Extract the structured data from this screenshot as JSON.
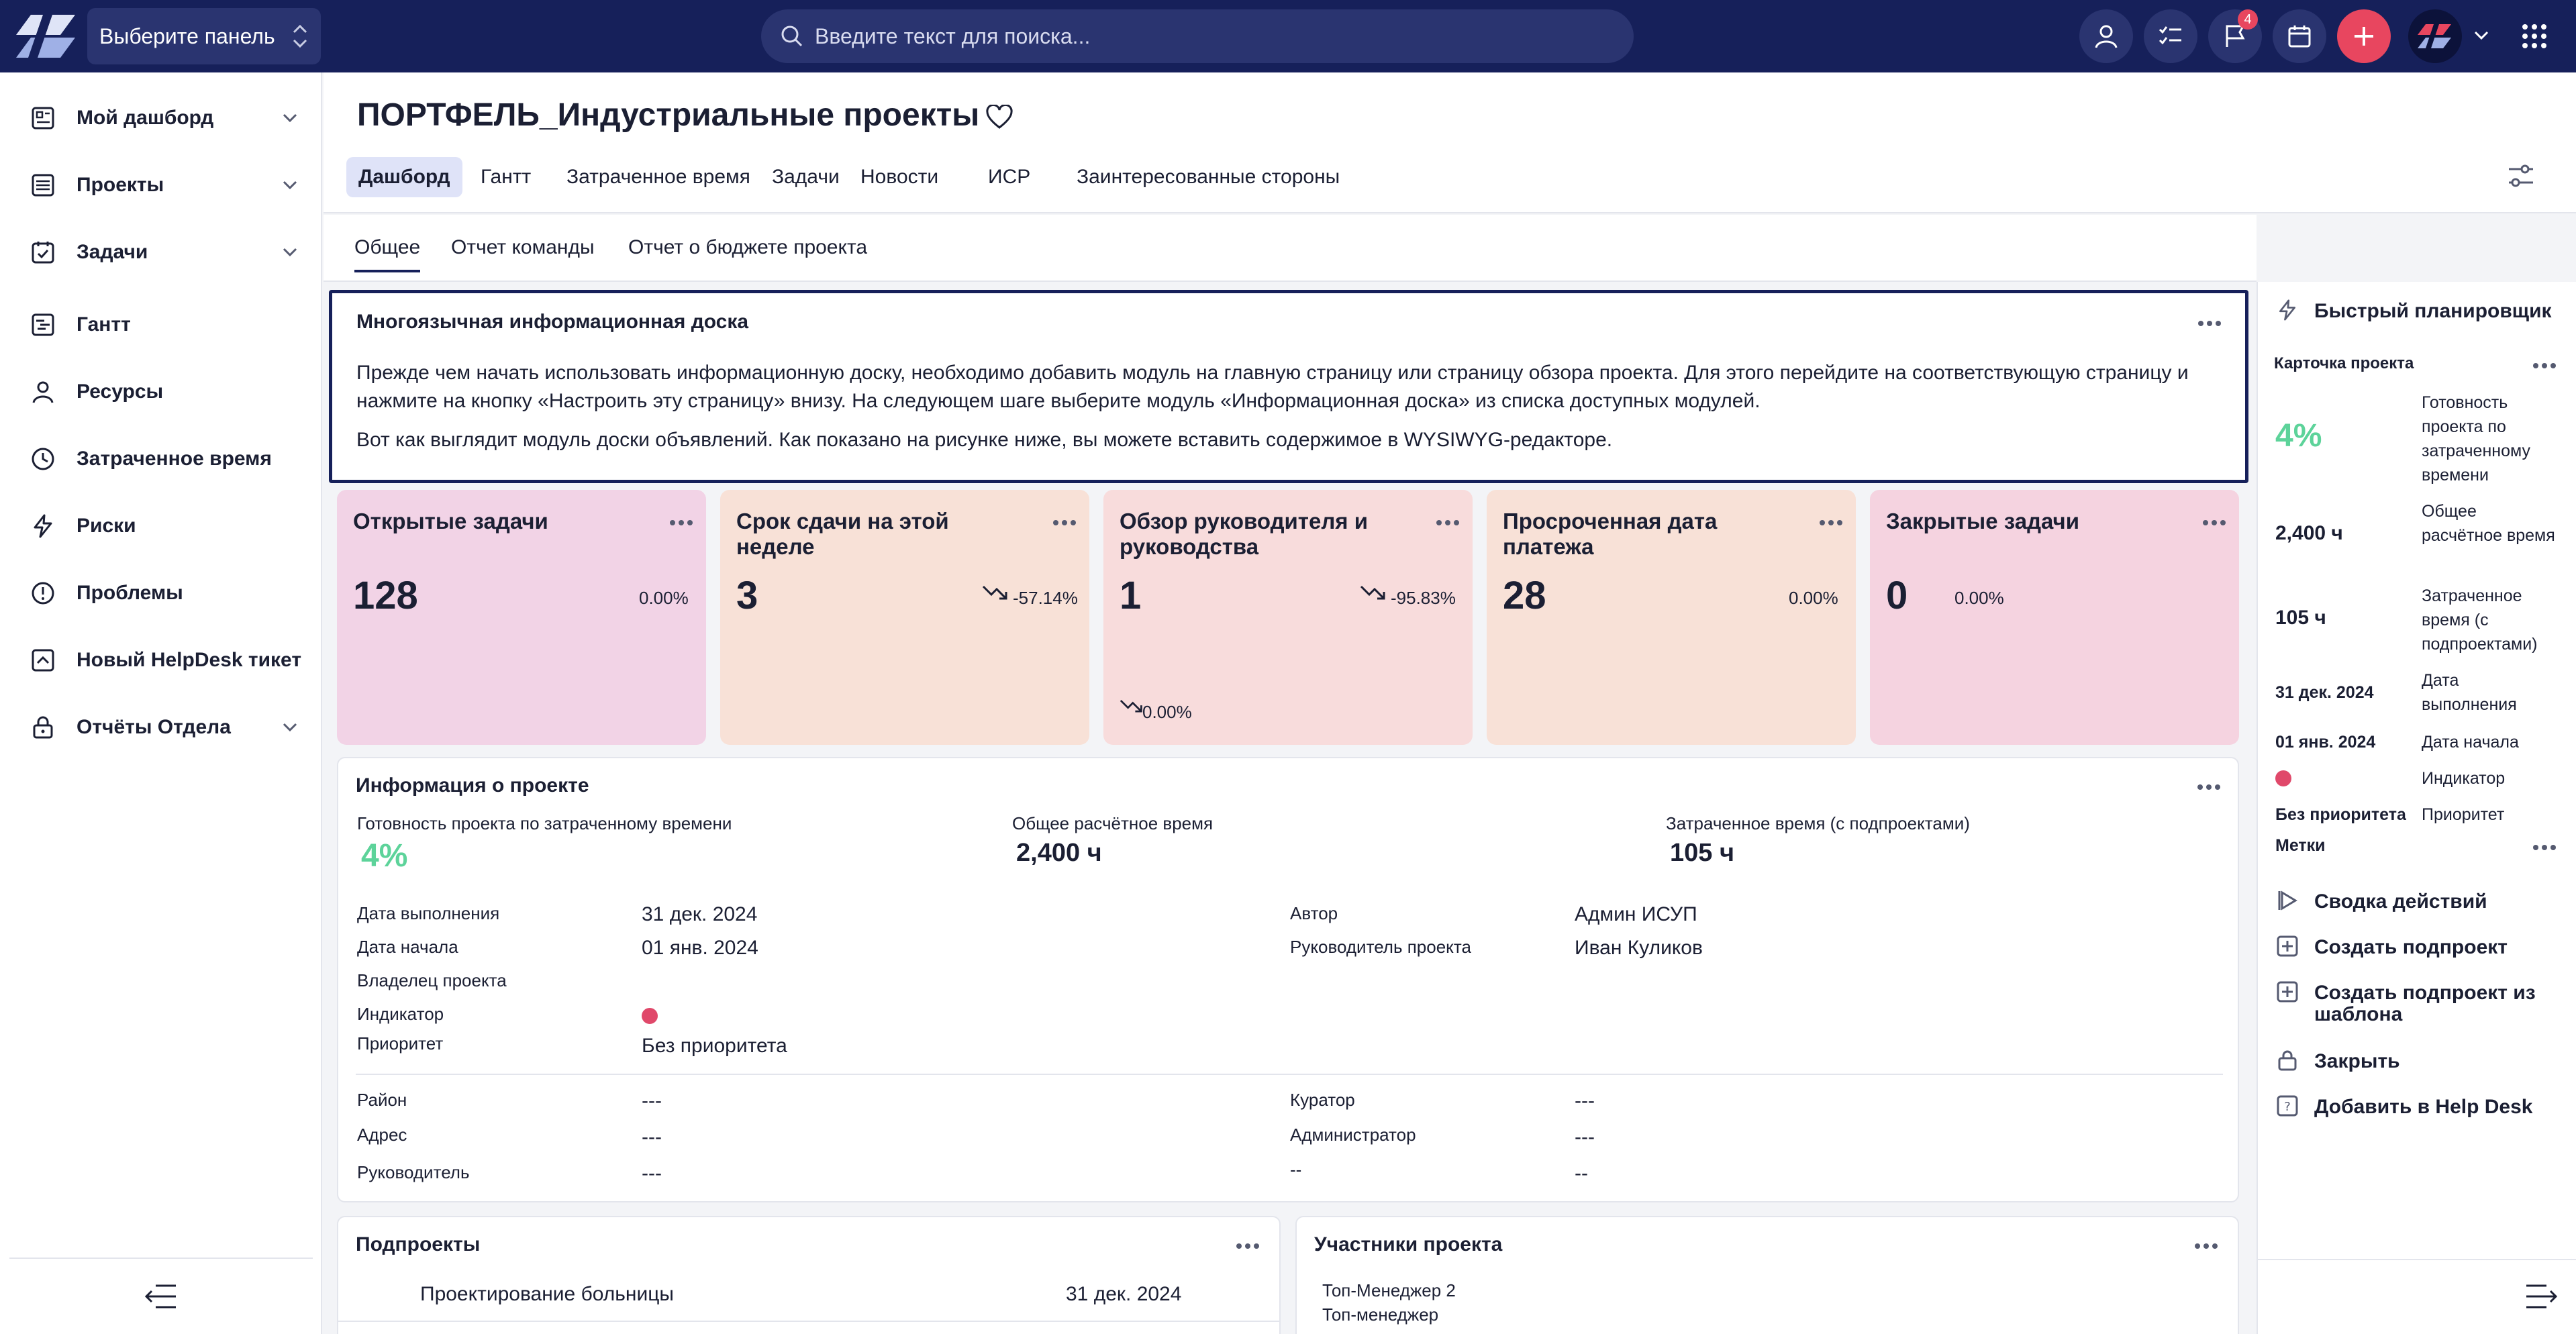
{
  "topbar": {
    "panel_select": "Выберите панель",
    "search_placeholder": "Введите текст для поиска...",
    "notifications_badge": "4",
    "colors": {
      "bar": "#16205a",
      "accent": "#e8465f"
    }
  },
  "sidebar": {
    "items": [
      {
        "label": "Мой дашборд",
        "icon": "dashboard-icon",
        "has_children": true
      },
      {
        "label": "Проекты",
        "icon": "projects-icon",
        "has_children": true
      },
      {
        "label": "Задачи",
        "icon": "tasks-icon",
        "has_children": true
      },
      {
        "label": "Гантт",
        "icon": "gantt-icon",
        "has_children": false
      },
      {
        "label": "Ресурсы",
        "icon": "user-icon",
        "has_children": false
      },
      {
        "label": "Затраченное время",
        "icon": "clock-icon",
        "has_children": false
      },
      {
        "label": "Риски",
        "icon": "lightning-icon",
        "has_children": false
      },
      {
        "label": "Проблемы",
        "icon": "alert-icon",
        "has_children": false
      },
      {
        "label": "Новый HelpDesk тикет",
        "icon": "helpdesk-icon",
        "has_children": false
      },
      {
        "label": "Отчёты Отдела",
        "icon": "lock-icon",
        "has_children": true
      }
    ]
  },
  "header": {
    "title": "ПОРТФЕЛЬ_Индустриальные проекты",
    "tabs": [
      "Дашборд",
      "Гантт",
      "Затраченное время",
      "Задачи",
      "Новости",
      "ИСР",
      "Заинтересованные стороны"
    ],
    "active_tab": "Дашборд"
  },
  "subtabs": {
    "items": [
      "Общее",
      "Отчет команды",
      "Отчет о бюджете проекта"
    ],
    "active": "Общее"
  },
  "board": {
    "title": "Многоязычная информационная доска",
    "p1": "Прежде чем начать использовать информационную доску, необходимо добавить модуль на главную страницу или страницу обзора проекта. Для этого перейдите на соответствующую страницу и",
    "p1b": "нажмите на кнопку «Настроить эту страницу» внизу. На следующем шаге выберите модуль «Информационная доска» из списка доступных модулей.",
    "p2": "Вот как выглядит модуль доски объявлений. Как показано на рисунке ниже, вы можете вставить содержимое в WYSIWYG-редакторе."
  },
  "kpis": [
    {
      "title": "Открытые задачи",
      "value": "128",
      "pct": "0.00%",
      "bg": "#f2d3e6",
      "trend": false
    },
    {
      "title": "Срок сдачи на этой неделе",
      "value": "3",
      "pct": "-57.14%",
      "bg": "#f8e1d7",
      "trend": true
    },
    {
      "title": "Обзор руководителя и руководства",
      "value": "1",
      "pct": "-95.83%",
      "pct2": "0.00%",
      "bg": "#f8dcdc",
      "trend": true
    },
    {
      "title": "Просроченная дата платежа",
      "value": "28",
      "pct": "0.00%",
      "bg": "#f8e1d7",
      "trend": false
    },
    {
      "title": "Закрытые задачи",
      "value": "0",
      "pct": "0.00%",
      "bg": "#f5d3e0",
      "trend": false
    }
  ],
  "project_info": {
    "title": "Информация о проекте",
    "readiness_label": "Готовность проекта по затраченному времени",
    "readiness_value": "4%",
    "estimated_label": "Общее расчётное время",
    "estimated_value": "2,400 ч",
    "spent_label": "Затраченное время (с подпроектами)",
    "spent_value": "105 ч",
    "due_label": "Дата выполнения",
    "due_value": "31 дек. 2024",
    "start_label": "Дата начала",
    "start_value": "01 янв. 2024",
    "owner_label": "Владелец проекта",
    "indicator_label": "Индикатор",
    "priority_label": "Приоритет",
    "priority_value": "Без приоритета",
    "author_label": "Автор",
    "author_value": "Админ ИСУП",
    "manager_label": "Руководитель проекта",
    "manager_value": "Иван Куликов",
    "district_label": "Район",
    "district_value": "---",
    "address_label": "Адрес",
    "address_value": "---",
    "head_label": "Руководитель",
    "head_value": "---",
    "curator_label": "Куратор",
    "curator_value": "---",
    "admin_label": "Администратор",
    "admin_value": "---",
    "extra_label": "--",
    "extra_value": "--",
    "indicator_color": "#e0486a"
  },
  "subprojects": {
    "title": "Подпроекты",
    "rows": [
      {
        "name": "Проектирование больницы",
        "date": "31 дек. 2024"
      }
    ]
  },
  "members": {
    "title": "Участники проекта",
    "lines": [
      "Топ-Менеджер 2",
      "Топ-менеджер"
    ]
  },
  "right_panel": {
    "quick_planner": "Быстрый планировщик",
    "card_title": "Карточка проекта",
    "readiness_value": "4%",
    "readiness_label": "Готовность проекта по затраченному времени",
    "estimated_value": "2,400 ч",
    "estimated_label": "Общее расчётное время",
    "spent_value": "105 ч",
    "spent_label": "Затраченное время (с подпроектами)",
    "due_value": "31 дек. 2024",
    "due_label": "Дата выполнения",
    "start_value": "01 янв. 2024",
    "start_label": "Дата начала",
    "indicator_label": "Индикатор",
    "priority_value": "Без приоритета",
    "priority_label": "Приоритет",
    "tags_label": "Метки",
    "actions": [
      "Сводка действий",
      "Создать подпроект",
      "Создать подпроект из шаблона",
      "Закрыть",
      "Добавить в Help Desk"
    ]
  }
}
